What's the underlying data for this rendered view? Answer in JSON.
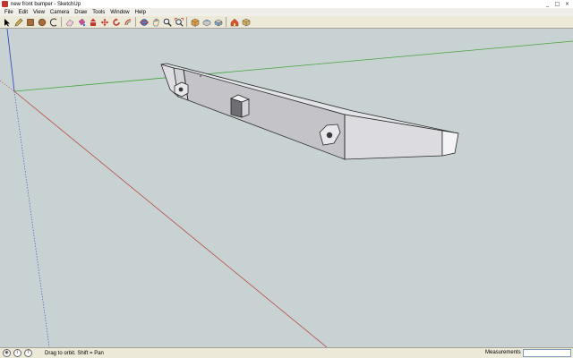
{
  "window": {
    "title": "new front bumper - SketchUp",
    "controls": [
      "_",
      "□",
      "×"
    ]
  },
  "menu": [
    "File",
    "Edit",
    "View",
    "Camera",
    "Draw",
    "Tools",
    "Window",
    "Help"
  ],
  "toolbar": {
    "tools": [
      "select-icon",
      "pencil-icon",
      "rectangle-icon",
      "circle-icon",
      "arc-icon",
      "eraser-icon",
      "paint-bucket-icon",
      "push-pull-icon",
      "move-icon",
      "rotate-icon",
      "offset-icon",
      "orbit-icon",
      "pan-icon",
      "zoom-icon",
      "zoom-extents-icon",
      "iso-view-icon",
      "top-view-icon",
      "front-view-icon",
      "warehouse-icon",
      "component-icon"
    ]
  },
  "status": {
    "hint": "Drag to orbit.  Shift = Pan",
    "measurements_label": "Measurements",
    "measurements_value": ""
  },
  "colors": {
    "x_axis": "#b54848",
    "y_axis": "#44a63c",
    "z_axis": "#3b4cc0",
    "background": "#c9d2d2"
  }
}
